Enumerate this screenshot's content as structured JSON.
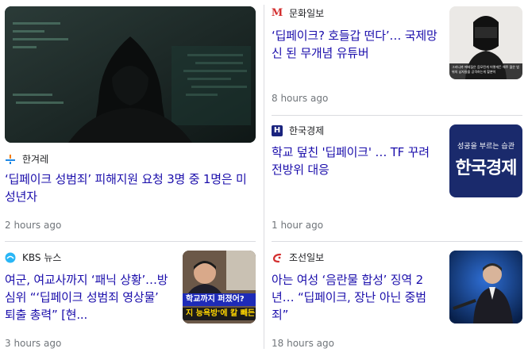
{
  "articles": [
    {
      "source": "한겨레",
      "headline": "‘딥페이크 성범죄’ 피해지원 요청 3명 중 1명은 미성년자",
      "time": "2 hours ago",
      "logo_color": "#1e88e5"
    },
    {
      "source": "문화일보",
      "headline": "‘딥페이크? 호들갑 떤다’… 국제망신 된 무개념 유튜버",
      "time": "8 hours ago",
      "logo_text": "M",
      "logo_color": "#d32f2f",
      "thumb_caption": "그러니까 에테잖은 음모된게 어떻게든 해주 많은 범위의 남자들을 공격하는게 할뿐이"
    },
    {
      "source": "한국경제",
      "headline": "학교 덮친 '딥페이크' … TF 꾸려 전방위 대응",
      "time": "1 hour ago",
      "logo_text": "H",
      "logo_color": "#1a237e",
      "thumb_line1": "성공을 부르는 습관",
      "thumb_line2": "한국경제"
    },
    {
      "source": "KBS 뉴스",
      "headline": "여군, 여교사까지 ‘패닉 상황’…방심위 “‘딥페이크 성범죄 영상물’ 퇴출 총력” [현...",
      "time": "3 hours ago",
      "logo_color": "#29b6f6",
      "thumb_text1": "학교까지 퍼졌어?",
      "thumb_text2": "지 능욕방'에 칼 빼든"
    },
    {
      "source": "조선일보",
      "headline": "아는 여성 ‘음란물 합성’ 징역 2년… “딥페이크, 장난 아닌 중범죄”",
      "time": "18 hours ago",
      "logo_color": "#d32f2f"
    }
  ]
}
